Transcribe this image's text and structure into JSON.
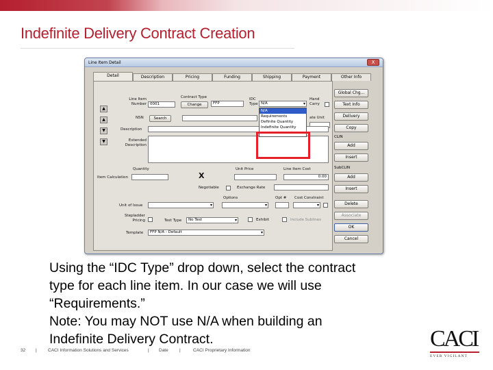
{
  "slide": {
    "title": "Indefinite Delivery Contract Creation",
    "caption_lines": [
      "Using the “IDC Type” drop down, select the contract",
      "type for each line item.  In our case we will use",
      "“Requirements.”",
      "Note: You may NOT use N/A when building an",
      "Indefinite Delivery Contract."
    ],
    "footer": {
      "page": "32",
      "sep": "|",
      "company": "CACI Information Solutions and Services",
      "date": "Date",
      "proprietary": "CACI Proprietary Information"
    },
    "logo": {
      "text": "CACI",
      "tagline": "EVER VIGILANT"
    },
    "colors": {
      "accent": "#b51f2e",
      "highlight": "#e6202a"
    }
  },
  "dialog": {
    "title": "Line Item Detail",
    "close_label": "X",
    "tabs": [
      "Detail",
      "Description",
      "Pricing",
      "Funding",
      "Shipping",
      "Payment",
      "Other Info"
    ],
    "fields": {
      "line_item_label": "Line Item Number",
      "line_item_value": "0001",
      "contract_type_label": "Contract Type",
      "change_label": "Change",
      "contract_type_value": "FFP",
      "idc_label": "IDC Type",
      "idc_value": "N/A",
      "hand_carry_label": "Hand Carry",
      "nsn_label": "NSN",
      "search_label": "Search",
      "unit_label": "ate Unit",
      "description_label": "Description",
      "extended_label": "Extended Description",
      "quantity_label": "Quantity",
      "unit_price_label": "Unit Price",
      "line_cost_label": "Line Item Cost",
      "line_cost_value": "0.00",
      "item_calc_label": "Item Calculation",
      "x_symbol": "X",
      "negotiable_label": "Negotiable",
      "exchange_label": "Exchange Rate",
      "options_label": "Options",
      "opt_label": "Opt #",
      "cost_constraint_label": "Cost Constraint",
      "unit_of_issue_label": "Unit of Issue",
      "stepladder_label": "Stepladder Pricing",
      "test_type_label": "Test Type",
      "test_type_value": "No Test",
      "exhibit_label": "Exhibit",
      "include_sublines_label": "Include Sublines",
      "template_label": "Template",
      "template_value": "FFP N/A - Default"
    },
    "idc_options": [
      "N/A",
      "Requirements",
      "Definite Quantity",
      "Indefinite Quantity"
    ],
    "side_buttons": {
      "global_chg": "Global Chg...",
      "text_info": "Text Info",
      "delivery": "Delivery",
      "copy": "Copy",
      "clin_label": "CLIN",
      "add": "Add",
      "insert": "Insert",
      "subclin_label": "SubCLIN",
      "add2": "Add",
      "insert2": "Insert",
      "delete": "Delete",
      "associate": "Associate",
      "ok": "OK",
      "cancel": "Cancel"
    },
    "arrow_buttons": [
      "▲",
      "▲",
      "▼",
      "▼"
    ]
  }
}
